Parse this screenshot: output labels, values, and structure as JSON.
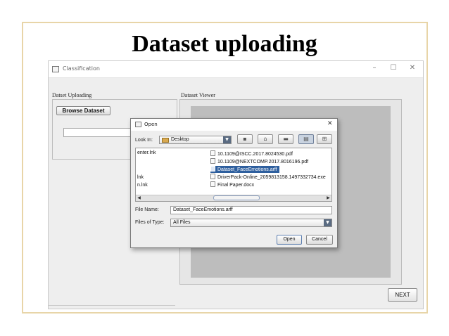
{
  "slide": {
    "title": "Dataset uploading"
  },
  "app": {
    "title": "Classification",
    "controls": {
      "minimize": "–",
      "maximize": "☐",
      "close": "✕"
    },
    "upload_panel_label": "Datset Uploading",
    "viewer_panel_label": "Dataset Viewer",
    "browse_button": "Browse Dataset",
    "path_value": "",
    "next_button": "NEXT"
  },
  "dialog": {
    "title": "Open",
    "close": "✕",
    "look_in_label": "Look In:",
    "look_in_value": "Desktop",
    "left_entries": [
      "enter.lnk",
      "lnk",
      "n.lnk"
    ],
    "files": [
      "10.1109@ISCC.2017.8024530.pdf",
      "10.1109@NEXTCOMP.2017.8016196.pdf",
      "Dataset_FaceEmotions.arff",
      "DriverPack-Online_2059813158.1497332734.exe",
      "Final Paper.docx"
    ],
    "selected_file": "Dataset_FaceEmotions.arff",
    "file_name_label": "File Name:",
    "file_name_value": "Dataset_FaceEmotions.arff",
    "files_of_type_label": "Files of Type:",
    "files_of_type_value": "All Files",
    "open_button": "Open",
    "cancel_button": "Cancel"
  },
  "colors": {
    "selection": "#2e5f9e",
    "frame": "#e8d5a8",
    "viewer_canvas": "#bdbdbd"
  }
}
